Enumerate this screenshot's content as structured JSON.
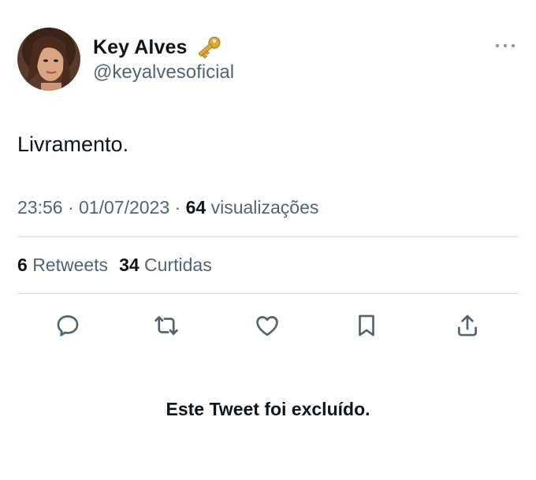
{
  "author": {
    "display_name": "Key Alves",
    "badge_icon": "key-icon",
    "handle": "@keyalvesoficial"
  },
  "tweet": {
    "text": "Livramento.",
    "time": "23:56",
    "separator": " · ",
    "date": "01/07/2023",
    "views_count": "64",
    "views_label": "visualizações"
  },
  "stats": {
    "retweets_count": "6",
    "retweets_label": "Retweets",
    "likes_count": "34",
    "likes_label": "Curtidas"
  },
  "actions": [
    "reply-icon",
    "retweet-icon",
    "like-icon",
    "bookmark-icon",
    "share-icon"
  ],
  "notice": "Este Tweet foi excluído.",
  "colors": {
    "text_primary": "#0f1419",
    "text_secondary": "#536471",
    "divider": "#cfd9de",
    "icon": "#536471",
    "key_gold": "#e0a93b"
  }
}
